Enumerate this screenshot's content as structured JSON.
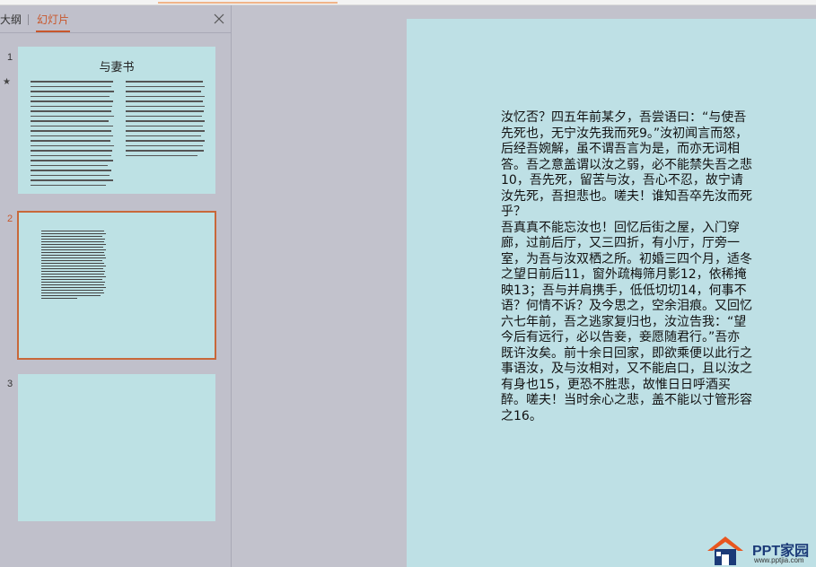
{
  "tabs": {
    "outline": "大纲",
    "slides": "幻灯片",
    "close_icon": "close-icon"
  },
  "thumbnails": [
    {
      "number": "1",
      "title": "与妻书",
      "star": "★"
    },
    {
      "number": "2"
    },
    {
      "number": "3"
    }
  ],
  "slide": {
    "text": "汝忆否？四五年前某夕，吾尝语曰：“与使吾先死也，无宁汝先我而死9。”汝初闻言而怒，后经吾婉解，虽不谓吾言为是，而亦无词相答。吾之意盖谓以汝之弱，必不能禁失吾之悲10，吾先死，留苦与汝，吾心不忍，故宁请汝先死，吾担悲也。嗟夫！谁知吾卒先汝而死乎？\n吾真真不能忘汝也！回忆后街之屋，入门穿廊，过前后厅，又三四折，有小厅，厅旁一室，为吾与汝双栖之所。初婚三四个月，适冬之望日前后11，窗外疏梅筛月影12，依稀掩映13；吾与并肩携手，低低切切14，何事不语？何情不诉？及今思之，空余泪痕。又回忆六七年前，吾之逃家复归也，汝泣告我：“望今后有远行，必以告妾，妾愿随君行。”吾亦既许汝矣。前十余日回家，即欲乘便以此行之事语汝，及与汝相对，又不能启口，且以汝之有身也15，更恐不胜悲，故惟日日呼酒买醉。嗟夫！当时余心之悲，盖不能以寸管形容之16。"
  },
  "logo": {
    "brand": "PPT家园",
    "url": "www.pptjia.com",
    "icon": "house-logo-icon"
  },
  "colors": {
    "accent": "#c8572c",
    "slide_bg": "#bee0e5",
    "panel_bg": "#c0c0cb"
  }
}
